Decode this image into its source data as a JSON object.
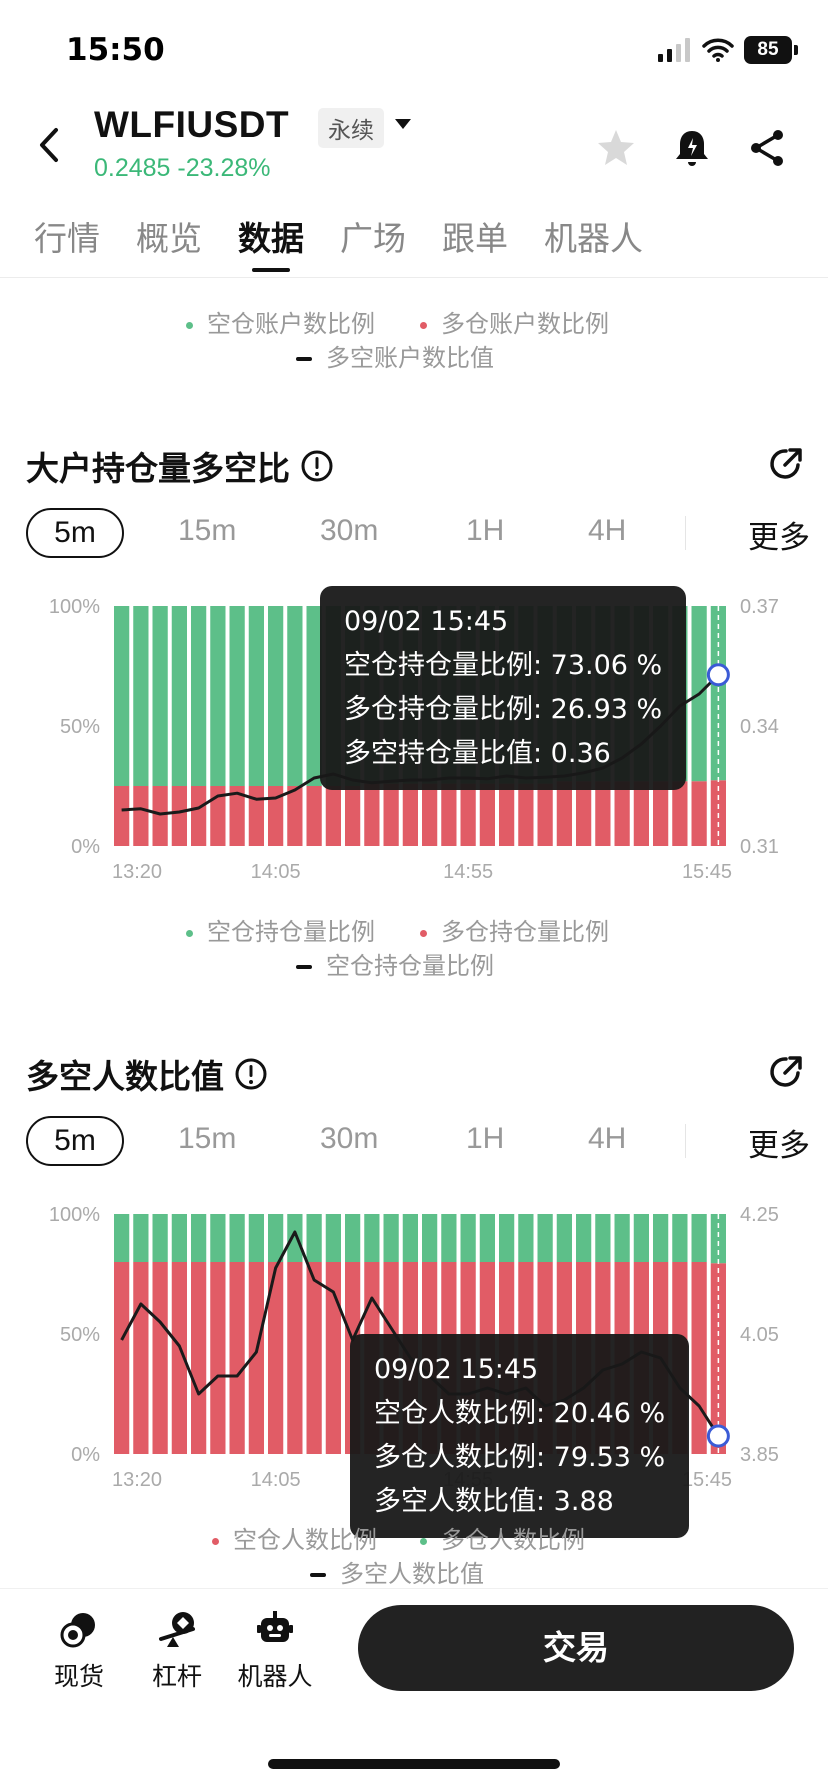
{
  "status": {
    "time": "15:50",
    "battery": "85"
  },
  "header": {
    "symbol": "WLFIUSDT",
    "contract_type": "永续",
    "price": "0.2485",
    "change": "-23.28%"
  },
  "tabs": [
    {
      "label": "行情",
      "active": false
    },
    {
      "label": "概览",
      "active": false
    },
    {
      "label": "数据",
      "active": true
    },
    {
      "label": "广场",
      "active": false
    },
    {
      "label": "跟单",
      "active": false
    },
    {
      "label": "机器人",
      "active": false
    }
  ],
  "top_legend": {
    "short": "空仓账户数比例",
    "long": "多仓账户数比例",
    "ratio": "多空账户数比值"
  },
  "intervals": [
    "5m",
    "15m",
    "30m",
    "1H",
    "4H"
  ],
  "more_label": "更多",
  "colors": {
    "green": "#5dbf89",
    "red": "#e15c66",
    "line": "#1a1a1a",
    "price_up": "#3bb878",
    "marker": "#3b5bd6"
  },
  "section1": {
    "title": "大户持仓量多空比",
    "legend": {
      "short": "空仓持仓量比例",
      "long": "多仓持仓量比例",
      "ratio": "空仓持仓量比例"
    },
    "tooltip": {
      "time": "09/02 15:45",
      "line1": "空仓持仓量比例: 73.06 %",
      "line2": "多仓持仓量比例: 26.93 %",
      "line3": "多空持仓量比值: 0.36"
    }
  },
  "section2": {
    "title": "多空人数比值",
    "legend": {
      "short": "空仓人数比例",
      "long": "多仓人数比例",
      "ratio": "多空人数比值"
    },
    "tooltip": {
      "time": "09/02 15:45",
      "line1": "空仓人数比例: 20.46 %",
      "line2": "多仓人数比例: 79.53 %",
      "line3": "多空人数比值: 3.88"
    }
  },
  "chart_data": [
    {
      "type": "bar",
      "title": "大户持仓量多空比",
      "x_ticks": [
        "13:20",
        "14:05",
        "14:55",
        "15:45"
      ],
      "y_left_ticks": [
        "100%",
        "50%",
        "0%"
      ],
      "y_right_ticks": [
        "0.37",
        "0.34",
        "0.31"
      ],
      "y_right_range": [
        0.31,
        0.37
      ],
      "series": [
        {
          "name": "多仓持仓量比例",
          "color": "#e15c66",
          "values": [
            25,
            25,
            25,
            25,
            25,
            25,
            25,
            25,
            25,
            25,
            25,
            25,
            25,
            26,
            26,
            26,
            26,
            26,
            26,
            26,
            26,
            26,
            26,
            27,
            27,
            27,
            27,
            27,
            27,
            27,
            27,
            27.4
          ]
        },
        {
          "name": "空仓持仓量比例",
          "color": "#5dbf89",
          "values": [
            75,
            75,
            75,
            75,
            75,
            75,
            75,
            75,
            75,
            75,
            75,
            75,
            75,
            74,
            74,
            74,
            74,
            74,
            74,
            74,
            74,
            74,
            74,
            73,
            73,
            73,
            73,
            73,
            73,
            73,
            73,
            72.6
          ]
        },
        {
          "name": "多空持仓量比值",
          "color": "#1a1a1a",
          "values": [
            0.319,
            0.3193,
            0.318,
            0.3185,
            0.3195,
            0.3225,
            0.3232,
            0.3217,
            0.322,
            0.324,
            0.327,
            0.328,
            0.3265,
            0.3258,
            0.3262,
            0.3265,
            0.3265,
            0.327,
            0.327,
            0.3268,
            0.3275,
            0.327,
            0.3272,
            0.3275,
            0.3283,
            0.3295,
            0.332,
            0.3355,
            0.34,
            0.345,
            0.348,
            0.3528
          ]
        }
      ]
    },
    {
      "type": "bar",
      "title": "多空人数比值",
      "x_ticks": [
        "13:20",
        "14:05",
        "14:55",
        "15:45"
      ],
      "y_left_ticks": [
        "100%",
        "50%",
        "0%"
      ],
      "y_right_ticks": [
        "4.25",
        "4.05",
        "3.85"
      ],
      "y_right_range": [
        3.85,
        4.25
      ],
      "series": [
        {
          "name": "多仓人数比例",
          "color": "#e15c66",
          "values": [
            80,
            80,
            80,
            80,
            80,
            80,
            80,
            80,
            80,
            80,
            80,
            80,
            80,
            80,
            80,
            80,
            80,
            80,
            80,
            80,
            80,
            80,
            80,
            80,
            80,
            80,
            80,
            80,
            80,
            80,
            80,
            79.5
          ]
        },
        {
          "name": "空仓人数比例",
          "color": "#5dbf89",
          "values": [
            20,
            20,
            20,
            20,
            20,
            20,
            20,
            20,
            20,
            20,
            20,
            20,
            20,
            20,
            20,
            20,
            20,
            20,
            20,
            20,
            20,
            20,
            20,
            20,
            20,
            20,
            20,
            20,
            20,
            20,
            20,
            20.5
          ]
        },
        {
          "name": "多空人数比值",
          "color": "#1a1a1a",
          "values": [
            4.04,
            4.1,
            4.07,
            4.03,
            3.95,
            3.98,
            3.98,
            4.02,
            4.16,
            4.22,
            4.14,
            4.12,
            4.04,
            4.11,
            4.06,
            4.01,
            3.98,
            3.95,
            3.95,
            3.96,
            3.95,
            3.96,
            3.93,
            3.94,
            3.96,
            3.99,
            4.0,
            4.02,
            4.01,
            3.96,
            3.93,
            3.88
          ]
        }
      ]
    }
  ],
  "bottom_nav": {
    "spot": "现货",
    "margin": "杠杆",
    "bot": "机器人",
    "trade": "交易"
  }
}
